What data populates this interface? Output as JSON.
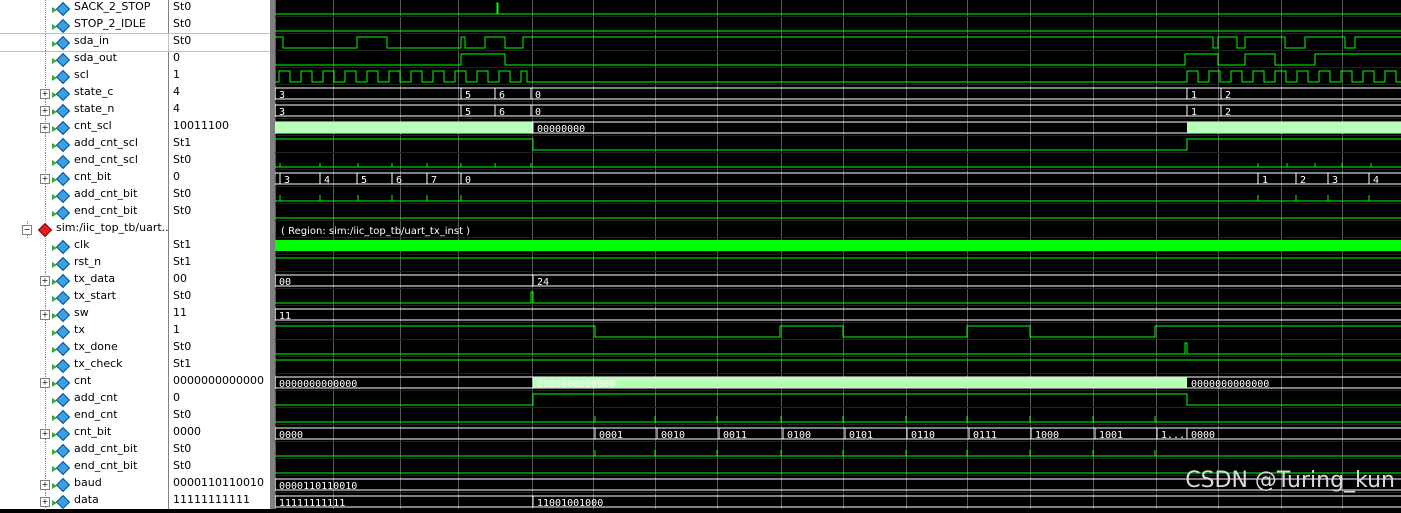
{
  "signals": [
    {
      "name": "SACK_2_STOP",
      "value": "St0",
      "indent": 1,
      "expand": false,
      "icon": "blue"
    },
    {
      "name": "STOP_2_IDLE",
      "value": "St0",
      "indent": 1,
      "expand": false,
      "icon": "blue"
    },
    {
      "name": "sda_in",
      "value": "St0",
      "indent": 1,
      "expand": false,
      "icon": "blue",
      "selected": true
    },
    {
      "name": "sda_out",
      "value": "0",
      "indent": 1,
      "expand": false,
      "icon": "blue"
    },
    {
      "name": "scl",
      "value": "1",
      "indent": 1,
      "expand": false,
      "icon": "blue"
    },
    {
      "name": "state_c",
      "value": "4",
      "indent": 1,
      "expand": true,
      "icon": "blue"
    },
    {
      "name": "state_n",
      "value": "4",
      "indent": 1,
      "expand": true,
      "icon": "blue"
    },
    {
      "name": "cnt_scl",
      "value": "10011100",
      "indent": 1,
      "expand": true,
      "icon": "blue"
    },
    {
      "name": "add_cnt_scl",
      "value": "St1",
      "indent": 1,
      "expand": false,
      "icon": "blue"
    },
    {
      "name": "end_cnt_scl",
      "value": "St0",
      "indent": 1,
      "expand": false,
      "icon": "blue"
    },
    {
      "name": "cnt_bit",
      "value": "0",
      "indent": 1,
      "expand": true,
      "icon": "blue"
    },
    {
      "name": "add_cnt_bit",
      "value": "St0",
      "indent": 1,
      "expand": false,
      "icon": "blue"
    },
    {
      "name": "end_cnt_bit",
      "value": "St0",
      "indent": 1,
      "expand": false,
      "icon": "blue"
    },
    {
      "name": "sim:/iic_top_tb/uart...",
      "value": "",
      "indent": 0,
      "expand": true,
      "expanded": true,
      "icon": "red"
    },
    {
      "name": "clk",
      "value": "St1",
      "indent": 1,
      "expand": false,
      "icon": "blue"
    },
    {
      "name": "rst_n",
      "value": "St1",
      "indent": 1,
      "expand": false,
      "icon": "blue"
    },
    {
      "name": "tx_data",
      "value": "00",
      "indent": 1,
      "expand": true,
      "icon": "blue"
    },
    {
      "name": "tx_start",
      "value": "St0",
      "indent": 1,
      "expand": false,
      "icon": "blue"
    },
    {
      "name": "sw",
      "value": "11",
      "indent": 1,
      "expand": true,
      "icon": "blue"
    },
    {
      "name": "tx",
      "value": "1",
      "indent": 1,
      "expand": false,
      "icon": "blue"
    },
    {
      "name": "tx_done",
      "value": "St0",
      "indent": 1,
      "expand": false,
      "icon": "blue"
    },
    {
      "name": "tx_check",
      "value": "St1",
      "indent": 1,
      "expand": false,
      "icon": "blue"
    },
    {
      "name": "cnt",
      "value": "0000000000000",
      "indent": 1,
      "expand": true,
      "icon": "blue"
    },
    {
      "name": "add_cnt",
      "value": "0",
      "indent": 1,
      "expand": false,
      "icon": "blue"
    },
    {
      "name": "end_cnt",
      "value": "St0",
      "indent": 1,
      "expand": false,
      "icon": "blue"
    },
    {
      "name": "cnt_bit",
      "value": "0000",
      "indent": 1,
      "expand": true,
      "icon": "blue"
    },
    {
      "name": "add_cnt_bit",
      "value": "St0",
      "indent": 1,
      "expand": false,
      "icon": "blue"
    },
    {
      "name": "end_cnt_bit",
      "value": "St0",
      "indent": 1,
      "expand": false,
      "icon": "blue"
    },
    {
      "name": "baud",
      "value": "0000110110010",
      "indent": 1,
      "expand": true,
      "icon": "blue"
    },
    {
      "name": "data",
      "value": "11111111111",
      "indent": 1,
      "expand": true,
      "icon": "blue"
    }
  ],
  "bus_labels": {
    "state_c": [
      "3",
      "5",
      "6",
      "0",
      "1",
      "2"
    ],
    "state_n": [
      "3",
      "5",
      "6",
      "0",
      "1",
      "2"
    ],
    "cnt_scl": [
      "00000000"
    ],
    "cnt_bit_i2c": [
      "3",
      "4",
      "5",
      "6",
      "7",
      "0",
      "1",
      "2",
      "3",
      "4"
    ],
    "region": "( Region: sim:/iic_top_tb/uart_tx_inst )",
    "tx_data": [
      "00",
      "24"
    ],
    "sw": [
      "11"
    ],
    "cnt": [
      "0000000000000",
      "0000000000000"
    ],
    "cnt_bit_uart": [
      "0000",
      "0001",
      "0010",
      "0011",
      "0100",
      "0101",
      "0110",
      "0111",
      "1000",
      "1001",
      "1...",
      "0000"
    ],
    "baud": [
      "0000110110010"
    ],
    "data": [
      "11111111111",
      "11001001000"
    ]
  },
  "watermark": "CSDN @Turing_kun",
  "colors": {
    "wave": "#00ff00",
    "bus_fill": "#b8ffb8",
    "grid": "#6b6b6b",
    "background": "#000000",
    "annotation": "#e0322e"
  }
}
